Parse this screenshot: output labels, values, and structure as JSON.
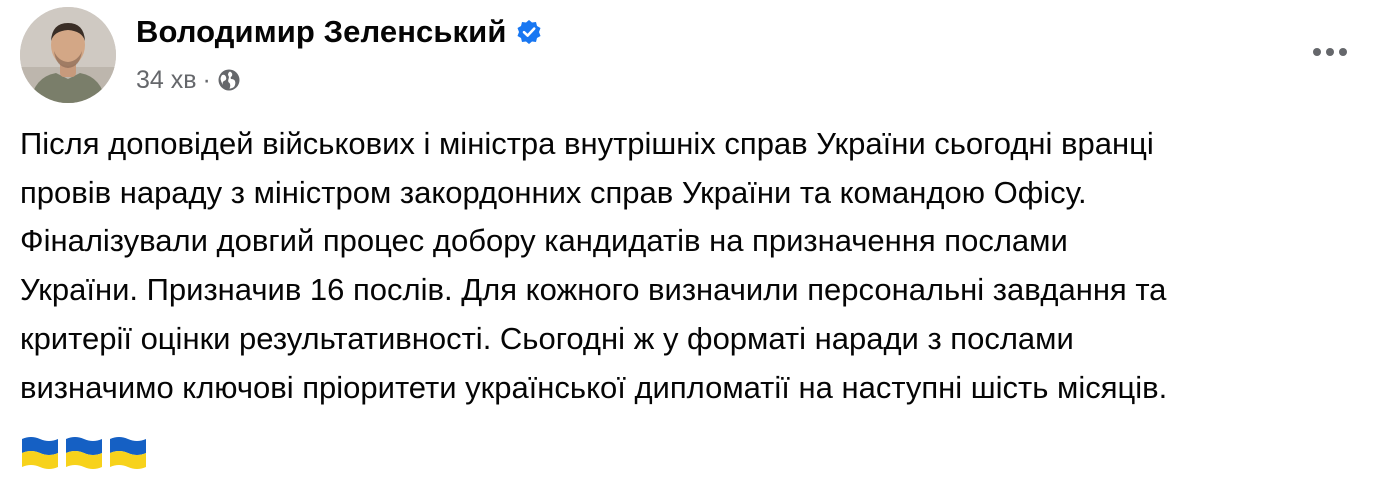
{
  "post": {
    "author": {
      "name": "Володимир Зеленський",
      "verified": true,
      "avatar_icon": "profile-photo"
    },
    "meta": {
      "time": "34 хв",
      "separator": "·",
      "audience_icon": "globe-icon"
    },
    "menu_icon": "more-options-icon",
    "text_lines": [
      "Після доповідей військових і міністра внутрішніх справ України сьогодні вранці",
      "провів нараду з міністром закордонних справ України та командою Офісу.",
      "Фіналізували довгий процес добору кандидатів на призначення послами",
      "України. Призначив 16 послів. Для кожного визначили персональні завдання та",
      "критерії оцінки результативності. Сьогодні ж у форматі наради з послами",
      "визначимо ключові пріоритети української дипломатії на наступні шість місяців."
    ],
    "emoji": [
      "ukraine-flag",
      "ukraine-flag",
      "ukraine-flag"
    ]
  },
  "colors": {
    "text": "#050505",
    "secondary": "#65676b",
    "verified_blue": "#1877f2",
    "flag_blue": "#1560c4",
    "flag_yellow": "#f7d21b"
  }
}
